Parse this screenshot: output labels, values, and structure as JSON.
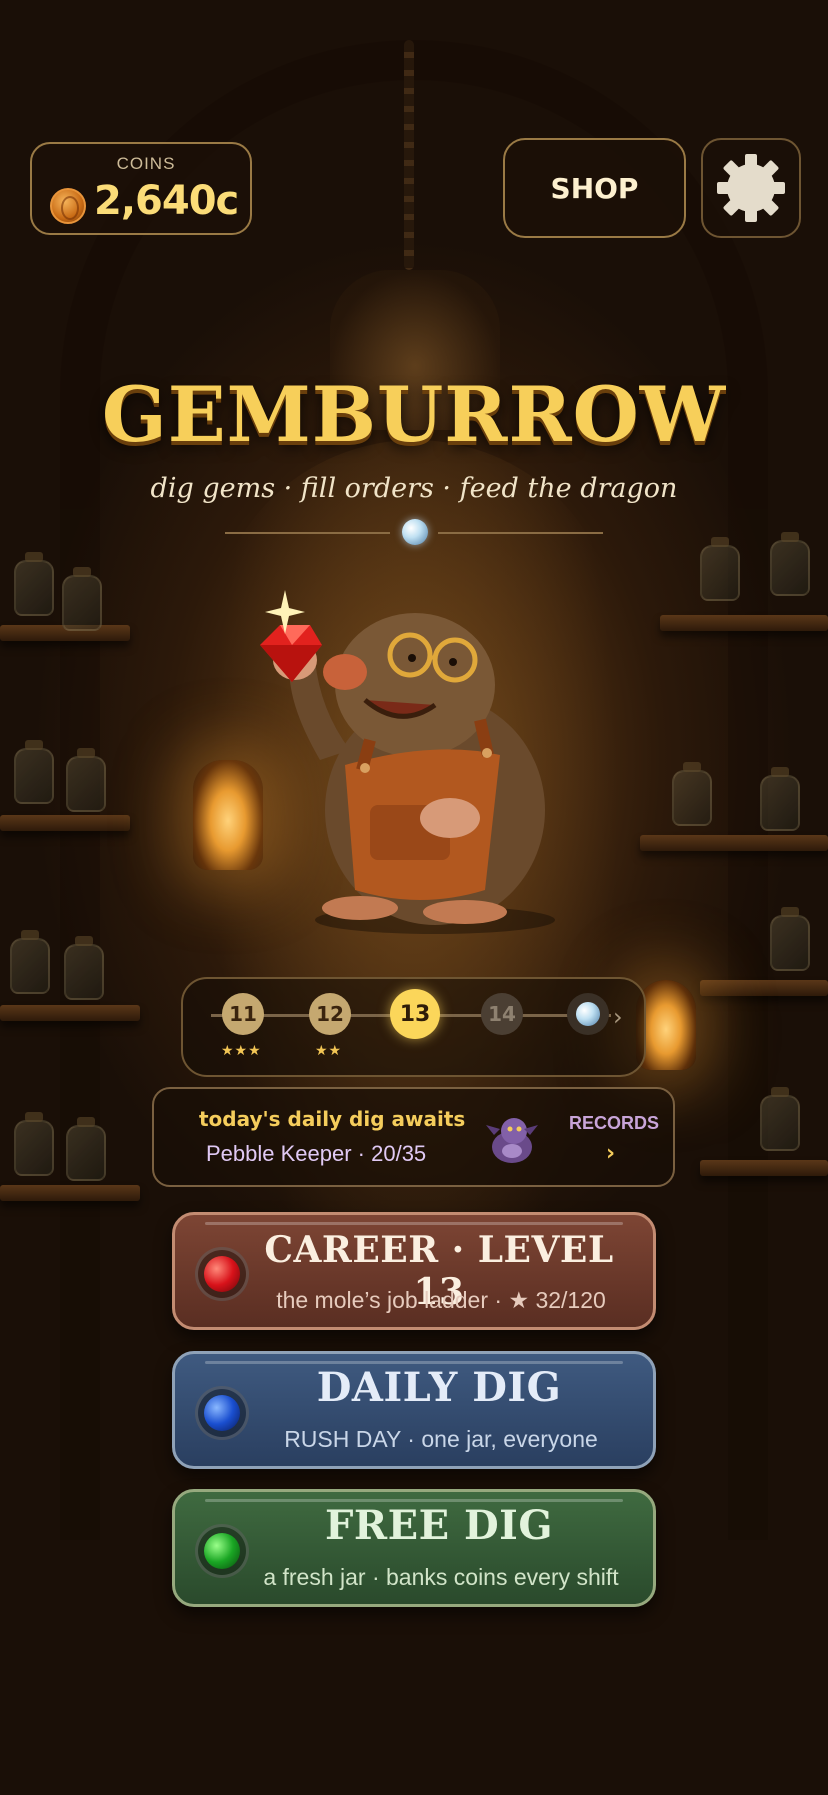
{
  "header": {
    "coins_label": "COINS",
    "coins_value": "2,640c",
    "coin_icon": "coin-icon",
    "shop_label": "SHOP",
    "settings_icon": "gear-icon"
  },
  "hero": {
    "title": "GEMBURROW",
    "subtitle": "dig gems · fill orders · feed the dragon"
  },
  "level_track": {
    "levels": [
      {
        "number": "11",
        "stars": "★★★",
        "state": "done"
      },
      {
        "number": "12",
        "stars": "★★",
        "state": "done"
      },
      {
        "number": "13",
        "stars": "",
        "state": "current"
      },
      {
        "number": "14",
        "stars": "",
        "state": "locked"
      }
    ],
    "reward_icon": "orb-icon",
    "next_arrow": "›"
  },
  "daily_banner": {
    "headline": "today's daily dig awaits",
    "progress_text": "Pebble Keeper · 20/35",
    "progress": {
      "current": 20,
      "total": 35
    },
    "records_label": "RECORDS",
    "records_arrow": "›"
  },
  "modes": [
    {
      "title": "CAREER · LEVEL 13",
      "subtitle": "the mole’s job ladder · ★ 32/120",
      "gem": "red-gem-icon",
      "color": "#7d4534"
    },
    {
      "title": "DAILY DIG",
      "subtitle": "RUSH DAY · one jar, everyone",
      "gem": "blue-gem-icon",
      "color": "#3f5a80"
    },
    {
      "title": "FREE DIG",
      "subtitle": "a fresh jar · banks coins every shift",
      "gem": "green-gem-icon",
      "color": "#3f6a40"
    }
  ],
  "colors": {
    "title_gold": "#f7cf5a",
    "accent_gold": "#fbd65a",
    "panel_border": "#9a7a45"
  }
}
